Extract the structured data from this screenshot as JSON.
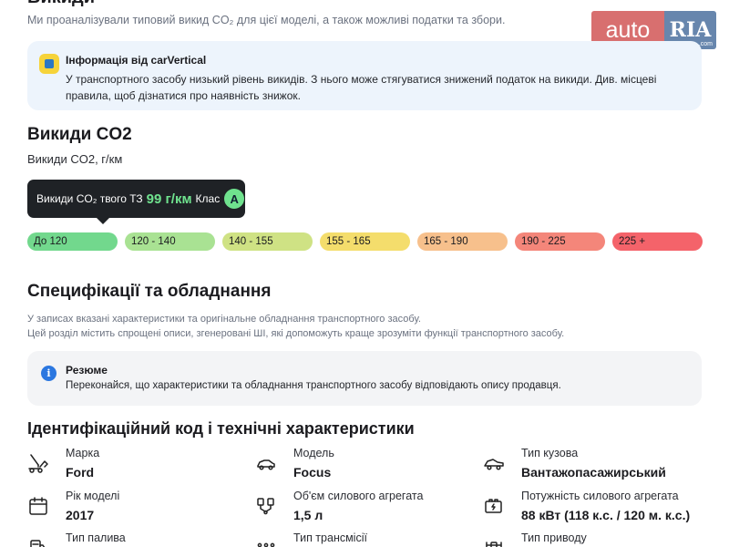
{
  "header": {
    "title": "Викиди",
    "subtitle": "Ми проаналізували типовий викид CO₂ для цієї моделі, а також можливі податки та збори."
  },
  "watermark": {
    "auto": "auto",
    "ria": "RIA",
    "com": ".com"
  },
  "carvertical_card": {
    "title": "Інформація від carVertical",
    "text": "У транспортного засобу низький рівень викидів. З нього може стягуватися знижений податок на викиди. Див. місцеві правила, щоб дізнатися про наявність знижок."
  },
  "emissions": {
    "heading": "Викиди CO2",
    "unit_label": "Викиди CO2, г/км",
    "tooltip": {
      "prefix": "Викиди CO₂ твого ТЗ",
      "value": "99 г/км",
      "class_label": "Клас",
      "class_value": "A"
    },
    "scale": [
      {
        "label": "До 120",
        "color": "#72d88d"
      },
      {
        "label": "120 - 140",
        "color": "#a9e293"
      },
      {
        "label": "140 - 155",
        "color": "#cfe284"
      },
      {
        "label": "155 - 165",
        "color": "#f4dd6c"
      },
      {
        "label": "165 - 190",
        "color": "#f7c08c"
      },
      {
        "label": "190 - 225",
        "color": "#f4867a"
      },
      {
        "label": "225 +",
        "color": "#f4636a"
      }
    ]
  },
  "specs": {
    "heading": "Специфікації та обладнання",
    "desc_line1": "У записах вказані характеристики та оригінальне обладнання транспортного засобу.",
    "desc_line2": "Цей розділ містить спрощені описи, згенеровані ШІ, які допоможуть краще зрозуміти функції транспортного засобу.",
    "resume_title": "Резюме",
    "resume_text": "Переконайся, що характеристики та обладнання транспортного засобу відповідають опису продавця."
  },
  "identification": {
    "heading": "Ідентифікаційний код і технічні характеристики",
    "props": {
      "make": {
        "label": "Марка",
        "value": "Ford",
        "icon": "tow-truck-icon"
      },
      "model": {
        "label": "Модель",
        "value": "Focus",
        "icon": "car-icon"
      },
      "body": {
        "label": "Тип кузова",
        "value": "Вантажопасажирський",
        "icon": "car-body-icon"
      },
      "year": {
        "label": "Рік моделі",
        "value": "2017",
        "icon": "calendar-icon"
      },
      "engine_volume": {
        "label": "Об'єм силового агрегата",
        "value": "1,5 л",
        "icon": "engine-pistons-icon"
      },
      "power": {
        "label": "Потужність силового агрегата",
        "value": "88 кВт (118 к.с. / 120 м. к.с.)",
        "icon": "battery-power-icon"
      },
      "fuel": {
        "label": "Тип палива",
        "value": "",
        "icon": "fuel-icon"
      },
      "transmission": {
        "label": "Тип трансмісії",
        "value": "",
        "icon": "gearbox-icon"
      },
      "drive": {
        "label": "Тип приводу",
        "value": "",
        "icon": "drive-axle-icon"
      }
    }
  }
}
